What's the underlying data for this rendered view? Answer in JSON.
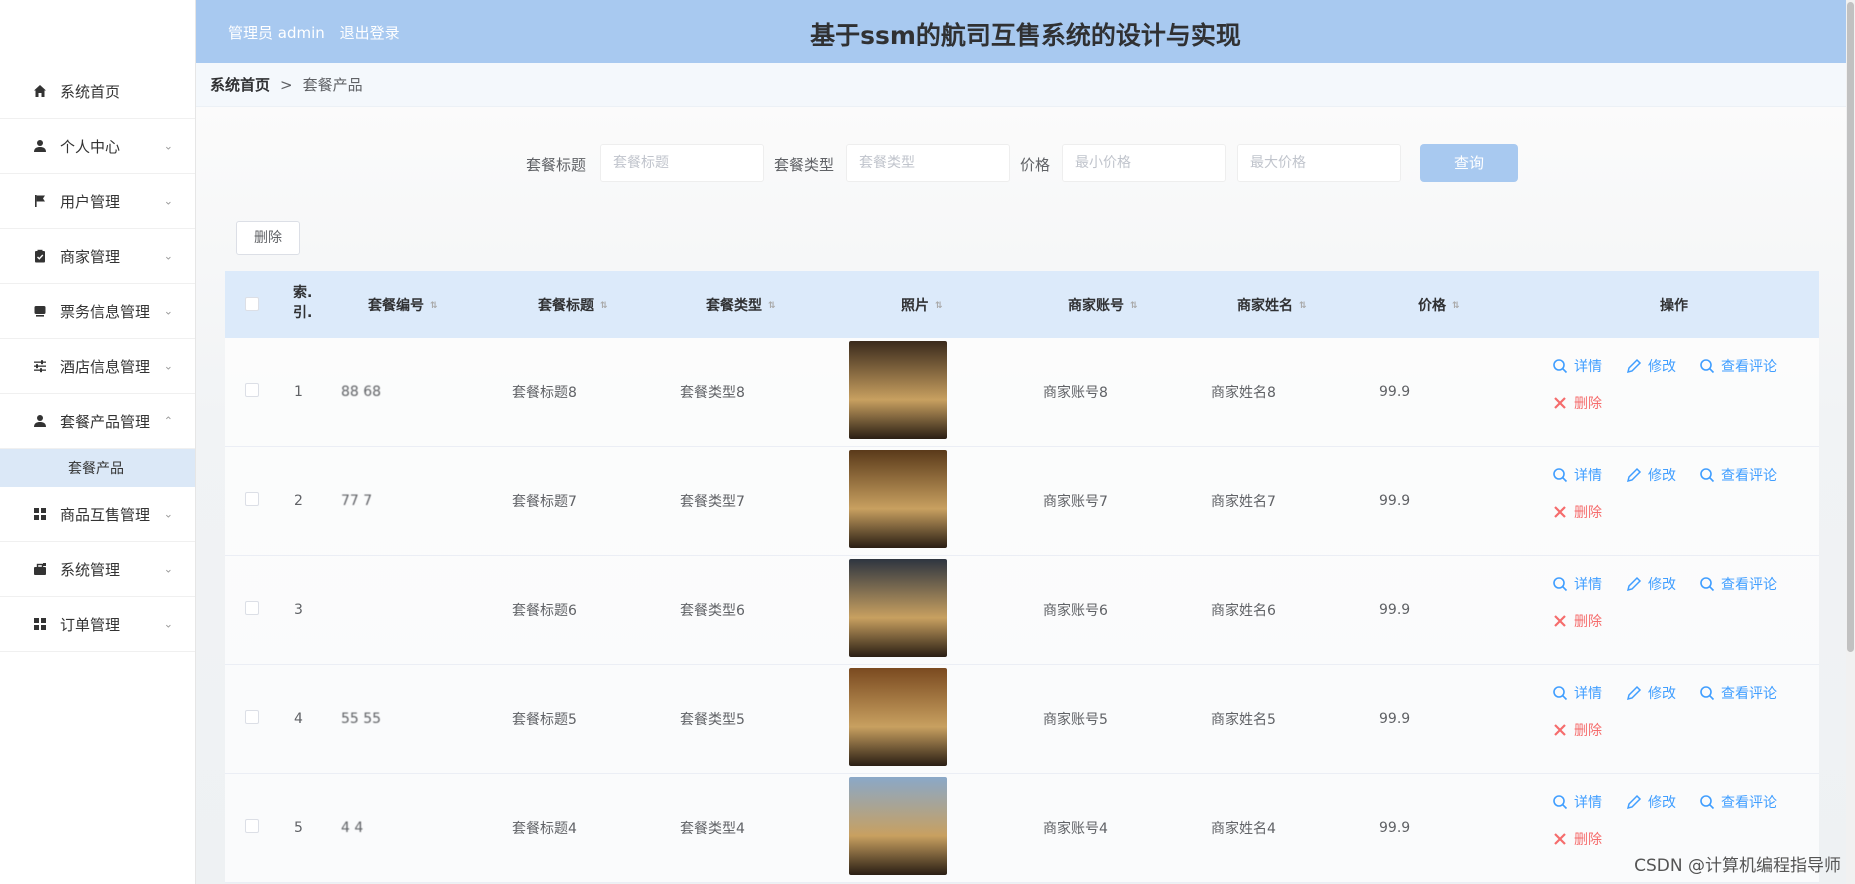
{
  "header": {
    "admin_label": "管理员 admin",
    "logout_label": "退出登录",
    "title": "基于ssm的航司互售系统的设计与实现"
  },
  "sidebar": {
    "items": [
      {
        "label": "系统首页",
        "icon": "home-icon",
        "chevron": ""
      },
      {
        "label": "个人中心",
        "icon": "user-icon",
        "chevron": "⌄"
      },
      {
        "label": "用户管理",
        "icon": "flag-icon",
        "chevron": "⌄"
      },
      {
        "label": "商家管理",
        "icon": "clipboard-icon",
        "chevron": "⌄"
      },
      {
        "label": "票务信息管理",
        "icon": "ticket-icon",
        "chevron": "⌄"
      },
      {
        "label": "酒店信息管理",
        "icon": "sliders-icon",
        "chevron": "⌄"
      },
      {
        "label": "套餐产品管理",
        "icon": "user-icon",
        "chevron": "⌃"
      }
    ],
    "submenu": {
      "label": "套餐产品"
    },
    "items2": [
      {
        "label": "商品互售管理",
        "icon": "grid-icon",
        "chevron": "⌄"
      },
      {
        "label": "系统管理",
        "icon": "briefcase-icon",
        "chevron": "⌄"
      },
      {
        "label": "订单管理",
        "icon": "grid-icon",
        "chevron": "⌄"
      }
    ]
  },
  "breadcrumb": {
    "home": "系统首页",
    "separator": ">",
    "current": "套餐产品"
  },
  "search": {
    "title_label": "套餐标题",
    "title_placeholder": "套餐标题",
    "type_label": "套餐类型",
    "type_placeholder": "套餐类型",
    "price_label": "价格",
    "min_placeholder": "最小价格",
    "max_placeholder": "最大价格",
    "query_button": "查询"
  },
  "delete_button": "删除",
  "table": {
    "headers": {
      "index_line1": "索.",
      "index_line2": "引.",
      "code": "套餐编号",
      "title": "套餐标题",
      "type": "套餐类型",
      "photo": "照片",
      "merchant_account": "商家账号",
      "merchant_name": "商家姓名",
      "price": "价格",
      "ops": "操作"
    },
    "ops_labels": {
      "detail": "详情",
      "edit": "修改",
      "comments": "查看评论",
      "delete": "删除"
    },
    "rows": [
      {
        "index": "1",
        "code": "88 68",
        "title": "套餐标题8",
        "type": "套餐类型8",
        "merchant_account": "商家账号8",
        "merchant_name": "商家姓名8",
        "price": "99.9",
        "photo_color": "#3a2a1c"
      },
      {
        "index": "2",
        "code": "77 7",
        "title": "套餐标题7",
        "type": "套餐类型7",
        "merchant_account": "商家账号7",
        "merchant_name": "商家姓名7",
        "price": "99.9",
        "photo_color": "#5a3a1a"
      },
      {
        "index": "3",
        "code": "",
        "title": "套餐标题6",
        "type": "套餐类型6",
        "merchant_account": "商家账号6",
        "merchant_name": "商家姓名6",
        "price": "99.9",
        "photo_color": "#2e3540"
      },
      {
        "index": "4",
        "code": "55 55",
        "title": "套餐标题5",
        "type": "套餐类型5",
        "merchant_account": "商家账号5",
        "merchant_name": "商家姓名5",
        "price": "99.9",
        "photo_color": "#7a4a20"
      },
      {
        "index": "5",
        "code": "4 4",
        "title": "套餐标题4",
        "type": "套餐类型4",
        "merchant_account": "商家账号4",
        "merchant_name": "商家姓名4",
        "price": "99.9",
        "photo_color": "#8aa8c8"
      }
    ]
  },
  "watermark": "CSDN @计算机编程指导师",
  "colors": {
    "header": "#a8c9f0",
    "link": "#409eff",
    "danger": "#f56c6c",
    "table_head": "#dceafa"
  }
}
